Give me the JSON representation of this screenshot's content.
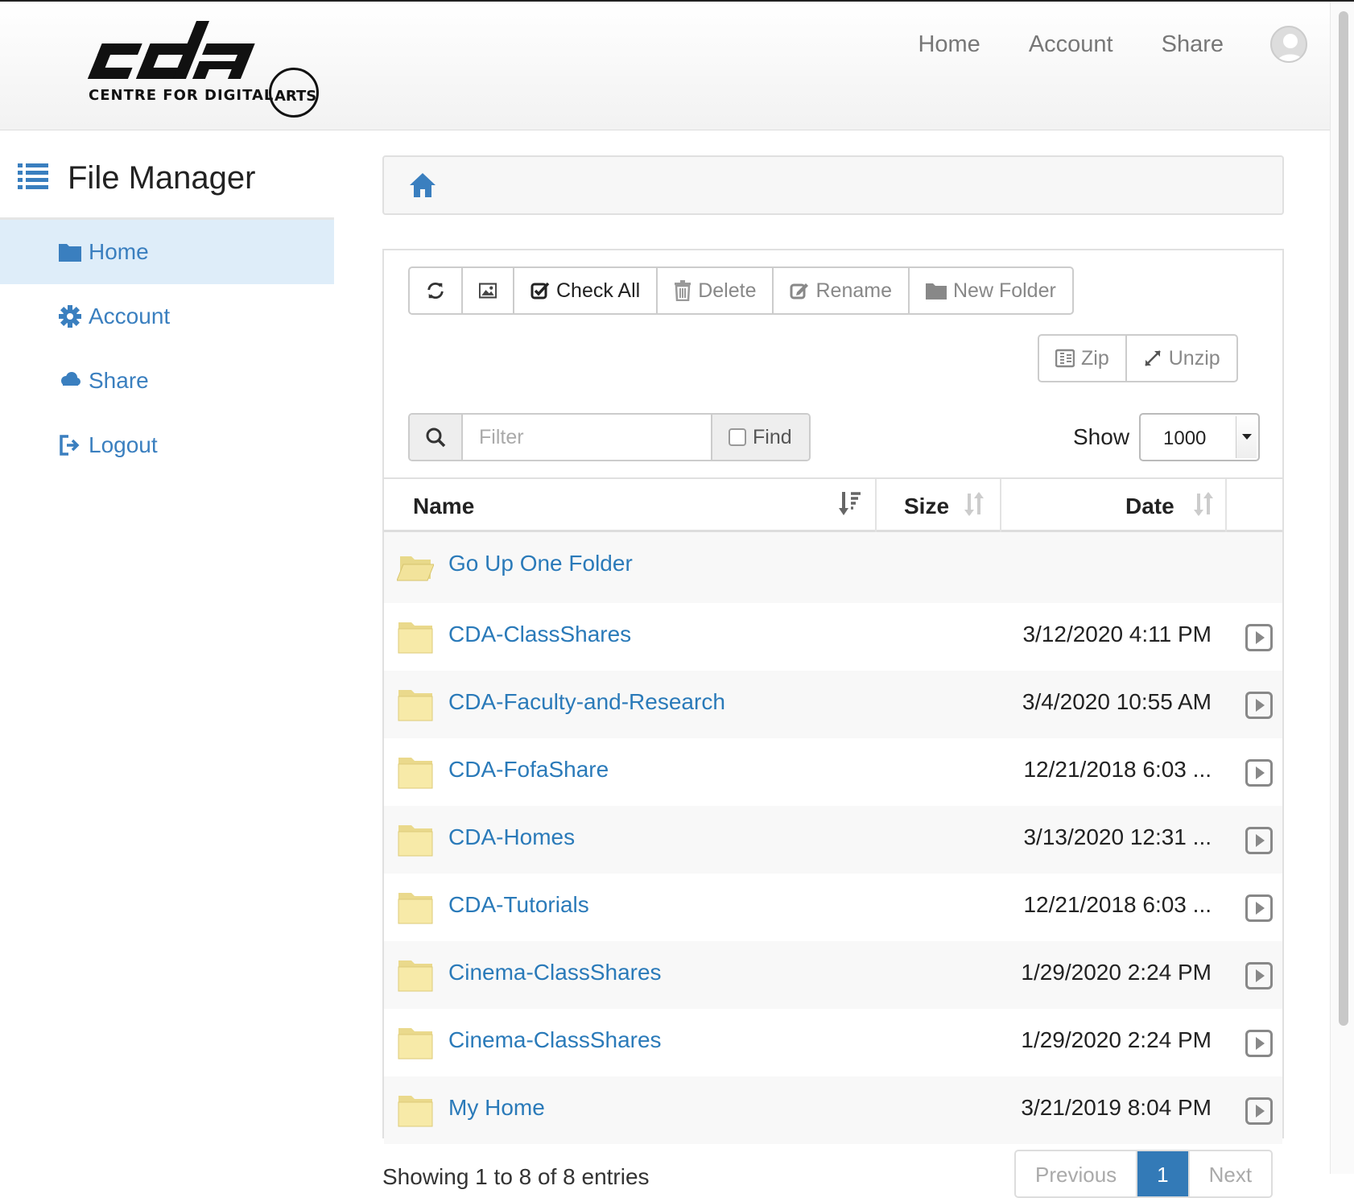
{
  "header": {
    "logo_text": "cda",
    "logo_subtitle": "CENTRE FOR DIGITAL",
    "logo_arts": "ARTS",
    "nav": [
      "Home",
      "Account",
      "Share"
    ]
  },
  "sidebar": {
    "title": "File Manager",
    "items": [
      {
        "label": "Home",
        "icon": "folder-icon",
        "active": true
      },
      {
        "label": "Account",
        "icon": "gear-icon",
        "active": false
      },
      {
        "label": "Share",
        "icon": "cloud-icon",
        "active": false
      },
      {
        "label": "Logout",
        "icon": "logout-icon",
        "active": false
      }
    ]
  },
  "toolbar": {
    "refresh_icon": "refresh-icon",
    "image_icon": "image-icon",
    "check_all": "Check All",
    "delete": "Delete",
    "rename": "Rename",
    "new_folder": "New Folder",
    "zip": "Zip",
    "unzip": "Unzip"
  },
  "filter": {
    "placeholder": "Filter",
    "find_label": "Find",
    "show_label": "Show",
    "show_value": "1000"
  },
  "table": {
    "columns": [
      "Name",
      "Size",
      "Date"
    ],
    "up_row": "Go Up One Folder",
    "rows": [
      {
        "name": "CDA-ClassShares",
        "size": "",
        "date": "3/12/2020 4:11 PM"
      },
      {
        "name": "CDA-Faculty-and-Research",
        "size": "",
        "date": "3/4/2020 10:55 AM"
      },
      {
        "name": "CDA-FofaShare",
        "size": "",
        "date": "12/21/2018 6:03 ..."
      },
      {
        "name": "CDA-Homes",
        "size": "",
        "date": "3/13/2020 12:31 ..."
      },
      {
        "name": "CDA-Tutorials",
        "size": "",
        "date": "12/21/2018 6:03 ..."
      },
      {
        "name": "Cinema-ClassShares",
        "size": "",
        "date": "1/29/2020 2:24 PM"
      },
      {
        "name": "Cinema-ClassShares",
        "size": "",
        "date": "1/29/2020 2:24 PM"
      },
      {
        "name": "My Home",
        "size": "",
        "date": "3/21/2019 8:04 PM"
      }
    ]
  },
  "footer": {
    "summary": "Showing 1 to 8 of 8 entries",
    "pager": [
      "Previous",
      "1",
      "Next"
    ]
  },
  "colors": {
    "link": "#2a7ab9",
    "active_bg": "#deedf9",
    "pager_active": "#337ab7"
  }
}
